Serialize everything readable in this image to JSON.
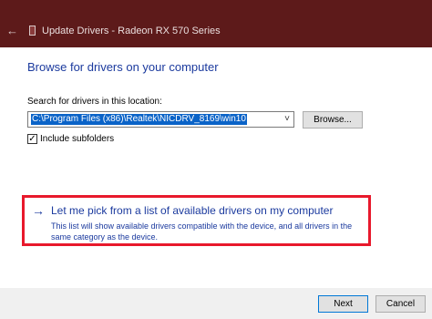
{
  "window": {
    "title": "Update Drivers - Radeon RX 570 Series",
    "back_icon": "back-arrow-icon",
    "device_icon": "device-icon"
  },
  "main": {
    "heading": "Browse for drivers on your computer",
    "search_label": "Search for drivers in this location:",
    "path_value": "C:\\Program Files (x86)\\Realtek\\NICDRV_8169\\win10",
    "combo_arrow": "˅",
    "browse_label": "Browse...",
    "include_subfolders_label": "Include subfolders",
    "include_subfolders_checked": true,
    "checkmark": "✓"
  },
  "pick_option": {
    "arrow": "→",
    "title": "Let me pick from a list of available drivers on my computer",
    "description": "This list will show available drivers compatible with the device, and all drivers in the same category as the device.",
    "highlight_color": "#e8192c"
  },
  "footer": {
    "next_label": "Next",
    "cancel_label": "Cancel"
  },
  "colors": {
    "titlebar": "#5d1a1a",
    "link_blue": "#1b3a9e",
    "selection_blue": "#0a63c8"
  }
}
